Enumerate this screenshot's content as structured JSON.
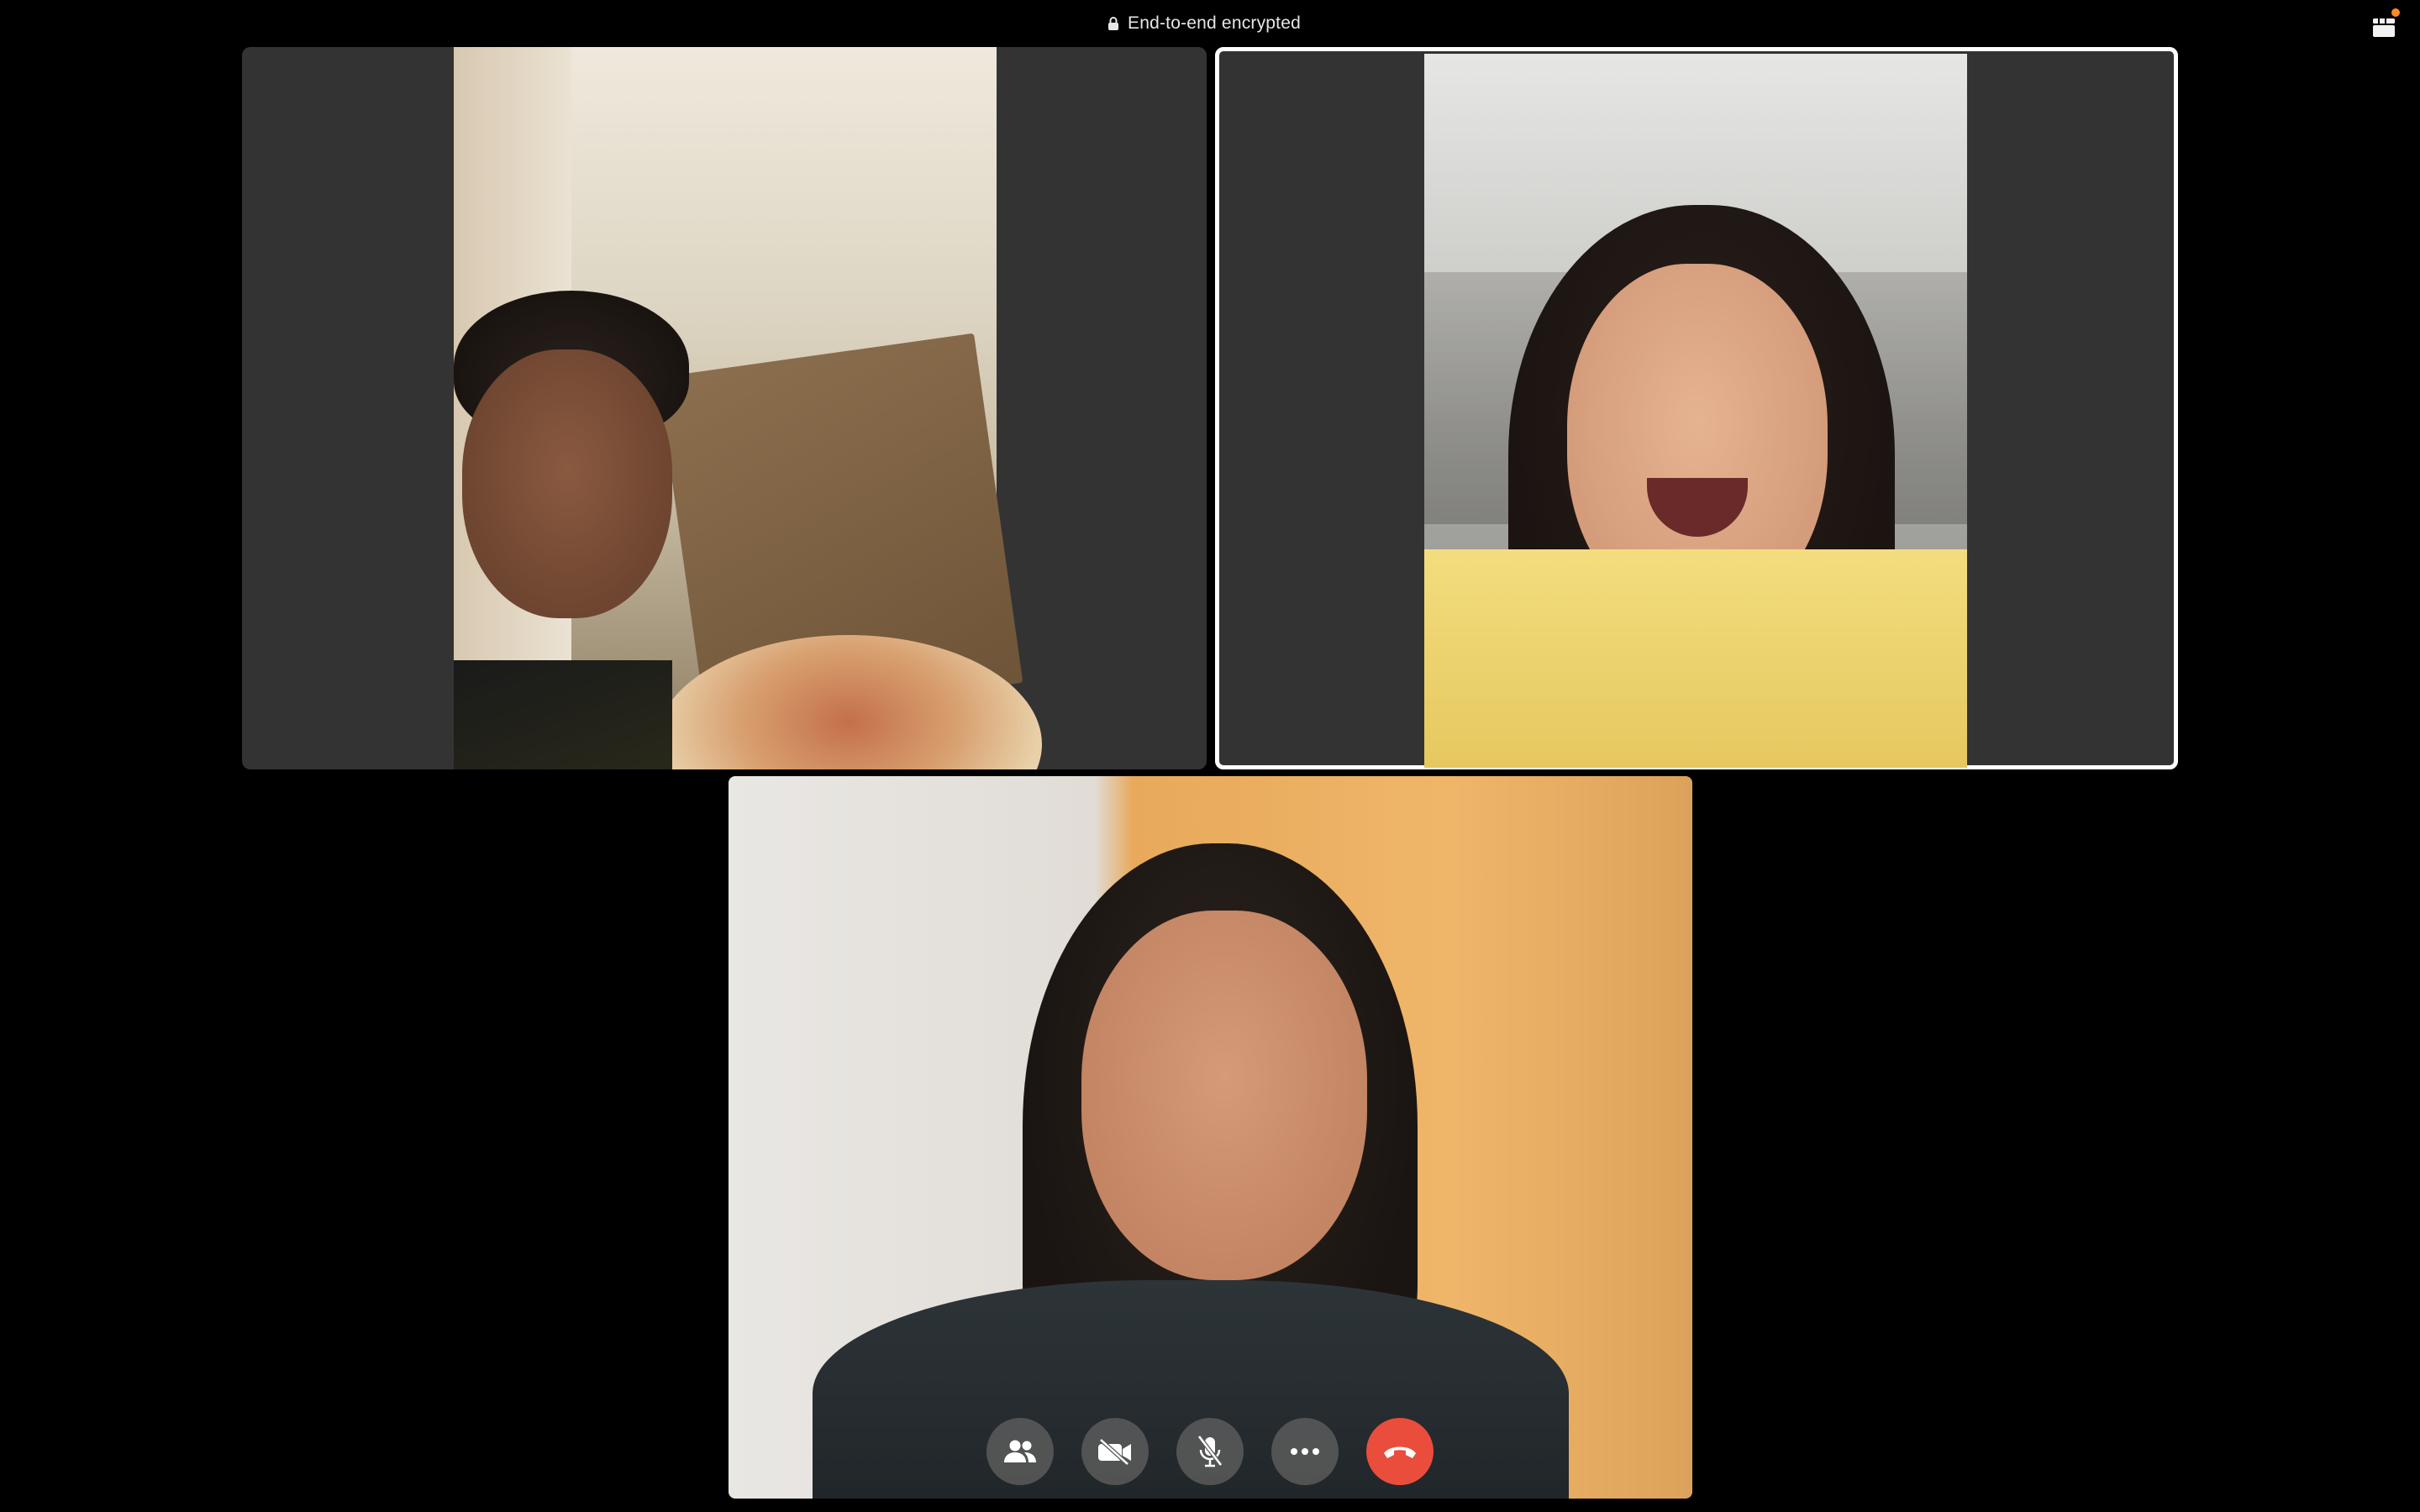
{
  "header": {
    "encryption_label": "End-to-end encrypted",
    "lock_icon": "lock-icon",
    "grid_icon": "grid-view-icon",
    "notification_color": "#ff8a2a"
  },
  "participants": [
    {
      "id": "participant-1",
      "active": false,
      "scene": "young man holding open pizza box"
    },
    {
      "id": "participant-2",
      "active": true,
      "scene": "woman with long hair in yellow shirt, laughing"
    },
    {
      "id": "self-view",
      "active": false,
      "scene": "woman with long hair smiling, orange curtain"
    }
  ],
  "controls": [
    {
      "name": "participants-button",
      "icon": "people-icon"
    },
    {
      "name": "camera-toggle-button",
      "icon": "video-off-icon"
    },
    {
      "name": "mic-toggle-button",
      "icon": "mic-off-icon"
    },
    {
      "name": "more-options-button",
      "icon": "more-horizontal-icon"
    },
    {
      "name": "end-call-button",
      "icon": "phone-hangup-icon",
      "color": "#eb4d3d"
    }
  ]
}
